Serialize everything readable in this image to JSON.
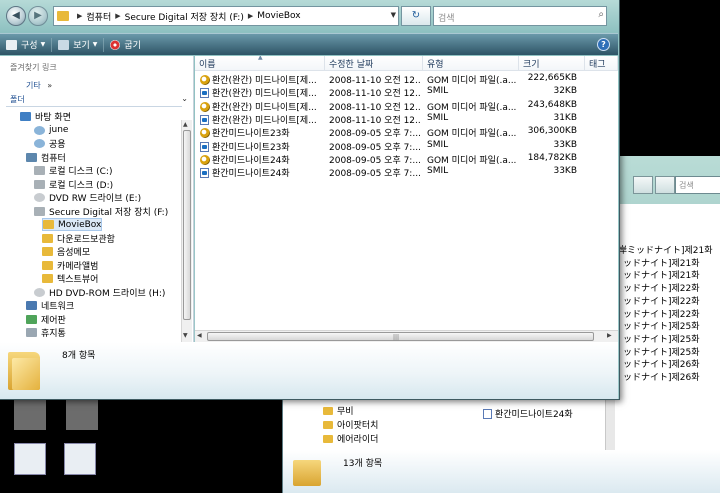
{
  "window": {
    "address": {
      "crumbs": [
        "컴퓨터",
        "Secure Digital 저장 장치 (F:)",
        "MovieBox"
      ]
    },
    "search_placeholder": "검색",
    "toolbar": {
      "organize": "구성",
      "view": "보기",
      "burn": "굽기",
      "help": "?"
    }
  },
  "nav": {
    "favorites_heading": "즐겨찾기 링크",
    "more": "기타",
    "more_chevron": "»",
    "folders_heading": "폴더",
    "tree": [
      {
        "label": "바탕 화면",
        "icon": "desktop-icon"
      },
      {
        "label": "june",
        "icon": "user-folder-icon"
      },
      {
        "label": "공용",
        "icon": "user-folder-icon"
      },
      {
        "label": "컴퓨터",
        "icon": "computer-icon"
      },
      {
        "label": "로컬 디스크 (C:)",
        "icon": "drive-icon"
      },
      {
        "label": "로컬 디스크 (D:)",
        "icon": "drive-icon"
      },
      {
        "label": "DVD RW 드라이브 (E:)",
        "icon": "dvd-drive-icon"
      },
      {
        "label": "Secure Digital 저장 장치 (F:)",
        "icon": "sd-card-icon"
      },
      {
        "label": "MovieBox",
        "icon": "folder-icon"
      },
      {
        "label": "다운로드보관함",
        "icon": "folder-icon"
      },
      {
        "label": "음성메모",
        "icon": "folder-icon"
      },
      {
        "label": "카메라앨범",
        "icon": "folder-icon"
      },
      {
        "label": "텍스트뷰어",
        "icon": "folder-icon"
      },
      {
        "label": "HD DVD-ROM 드라이브 (H:)",
        "icon": "dvd-drive-icon"
      },
      {
        "label": "네트워크",
        "icon": "network-icon"
      },
      {
        "label": "제어판",
        "icon": "control-panel-icon"
      },
      {
        "label": "휴지통",
        "icon": "recycle-bin-icon"
      }
    ]
  },
  "files": {
    "columns": [
      "이름",
      "수정한 날짜",
      "유형",
      "크기",
      "태그"
    ],
    "rows": [
      {
        "name": "환간(완간) 미드나이트[제...",
        "date": "2008-11-10 오전 12...",
        "type": "GOM 미디어 파일(.a...",
        "size": "222,665KB",
        "icon": "media-file-icon"
      },
      {
        "name": "환간(완간) 미드나이트[제...",
        "date": "2008-11-10 오전 12...",
        "type": "SMIL",
        "size": "32KB",
        "icon": "smil-file-icon"
      },
      {
        "name": "환간(완간) 미드나이트[제...",
        "date": "2008-11-10 오전 12...",
        "type": "GOM 미디어 파일(.a...",
        "size": "243,648KB",
        "icon": "media-file-icon"
      },
      {
        "name": "환간(완간) 미드나이트[제...",
        "date": "2008-11-10 오전 12...",
        "type": "SMIL",
        "size": "31KB",
        "icon": "smil-file-icon"
      },
      {
        "name": "환간미드나이트23화",
        "date": "2008-09-05 오후 7:...",
        "type": "GOM 미디어 파일(.a...",
        "size": "306,300KB",
        "icon": "media-file-icon"
      },
      {
        "name": "환간미드나이트23화",
        "date": "2008-09-05 오후 7:...",
        "type": "SMIL",
        "size": "33KB",
        "icon": "smil-file-icon"
      },
      {
        "name": "환간미드나이트24화",
        "date": "2008-09-05 오후 7:...",
        "type": "GOM 미디어 파일(.a...",
        "size": "184,782KB",
        "icon": "media-file-icon"
      },
      {
        "name": "환간미드나이트24화",
        "date": "2008-09-05 오후 7:...",
        "type": "SMIL",
        "size": "33KB",
        "icon": "smil-file-icon"
      }
    ]
  },
  "details": {
    "count": "8개 항목"
  },
  "background_window": {
    "search_placeholder": "검색",
    "right_items": [
      "湾岸ミッドナイト]제21화",
      "ッドナイト]제21화",
      "ッドナイト]제21화",
      "ッドナイト]제22화",
      "ッドナイト]제22화",
      "ッドナイト]제22화",
      "ッドナイト]제25화",
      "ッドナイト]제25화",
      "ッドナイト]제25화",
      "ッドナイト]제26화",
      "ッドナイト]제26화"
    ],
    "last_file": "환간미드나이트24화",
    "folders": [
      "무비",
      "아이팟터치",
      "에어라이더"
    ],
    "count": "13개 항목"
  },
  "colors": {
    "accent": "#1f4f92",
    "toolbar": "#2e5466",
    "chrome": "#9fc9cb"
  }
}
